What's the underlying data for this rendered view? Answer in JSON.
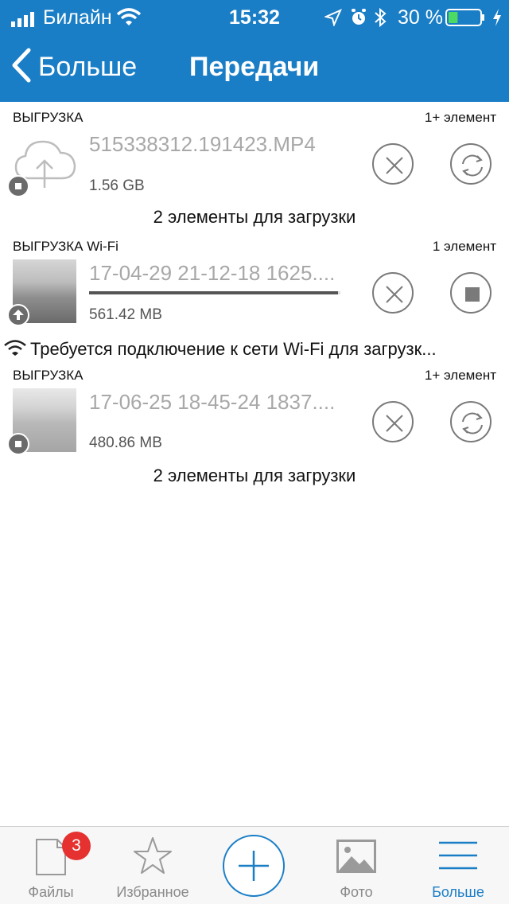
{
  "status_bar": {
    "carrier": "Билайн",
    "time": "15:32",
    "battery_percent": "30 %"
  },
  "nav": {
    "back_label": "Больше",
    "title": "Передачи"
  },
  "transfers": [
    {
      "type": "ВЫГРУЗКА",
      "count": "1+ элемент",
      "name": "515338312.191423.MP4",
      "size": "1.56 GB",
      "pending_note": "2 элементы для загрузки"
    },
    {
      "type": "ВЫГРУЗКА Wi-Fi",
      "count": "1 элемент",
      "name": "17-04-29 21-12-18 1625....",
      "size": "561.42 MB",
      "progress": 0.99,
      "warning": "Требуется подключение к сети Wi-Fi для загрузк..."
    },
    {
      "type": "ВЫГРУЗКА",
      "count": "1+ элемент",
      "name": "17-06-25 18-45-24 1837....",
      "size": "480.86 MB",
      "pending_note": "2 элементы для загрузки"
    }
  ],
  "tabbar": {
    "files_label": "Файлы",
    "files_badge": "3",
    "favorites_label": "Избранное",
    "photos_label": "Фото",
    "more_label": "Больше"
  },
  "colors": {
    "accent": "#1a7ec6",
    "badge": "#e5312f",
    "battery_fill": "#4cd964"
  }
}
